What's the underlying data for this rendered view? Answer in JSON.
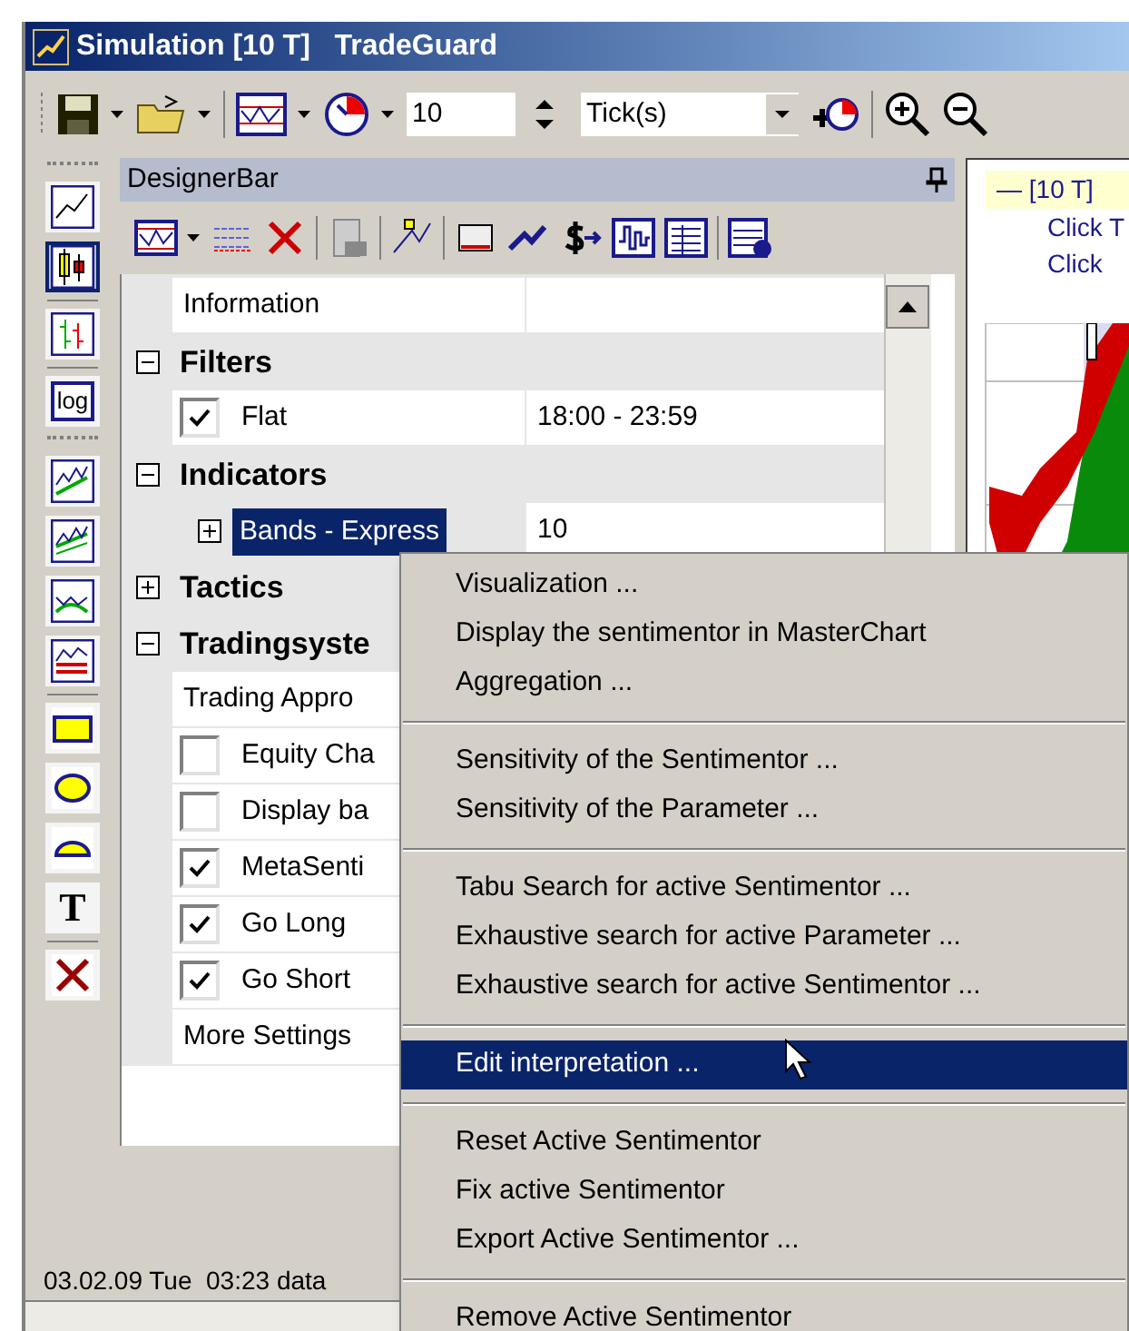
{
  "window": {
    "title": "Simulation [10 T]   TradeGuard"
  },
  "toolbar": {
    "period_value": "10",
    "unit": "Tick(s)"
  },
  "left_toolbar": {
    "tools": [
      {
        "selected": false
      },
      {
        "selected": true
      },
      {
        "selected": false
      },
      {
        "selected": false,
        "label": "log"
      },
      {
        "selected": false
      },
      {
        "selected": false
      },
      {
        "selected": false
      },
      {
        "selected": false
      },
      {
        "selected": false
      },
      {
        "selected": false
      },
      {
        "selected": false
      },
      {
        "selected": false,
        "label": "T"
      },
      {
        "selected": false
      }
    ]
  },
  "designer_bar": {
    "title": "DesignerBar",
    "rows": [
      {
        "kind": "property",
        "label": "Information"
      },
      {
        "kind": "category",
        "label": "Filters",
        "expanded": true,
        "children": [
          {
            "kind": "check",
            "label": "Flat",
            "checked": true,
            "value": "18:00 - 23:59"
          }
        ]
      },
      {
        "kind": "category",
        "label": "Indicators",
        "expanded": true,
        "children": [
          {
            "kind": "node",
            "label": "Bands - Express",
            "expanded": false,
            "selected": true,
            "value": "10"
          }
        ]
      },
      {
        "kind": "category",
        "label": "Tactics",
        "expanded": false
      },
      {
        "kind": "category",
        "label": "Tradingsyste",
        "expanded": true,
        "children": [
          {
            "kind": "property",
            "label": "Trading Appro"
          },
          {
            "kind": "check",
            "label": "Equity Cha",
            "checked": false
          },
          {
            "kind": "check",
            "label": "Display ba",
            "checked": false
          },
          {
            "kind": "check",
            "label": "MetaSenti",
            "checked": true
          },
          {
            "kind": "check",
            "label": "Go Long",
            "checked": true
          },
          {
            "kind": "check",
            "label": "Go Short",
            "checked": true
          },
          {
            "kind": "property",
            "label": "More Settings"
          }
        ]
      }
    ],
    "status": "03.02.09 Tue  03:23 data"
  },
  "chart": {
    "legend": "— [10 T]",
    "hints": [
      "Click T",
      "Click"
    ]
  },
  "context_menu": [
    {
      "kind": "item",
      "label": "Visualization ...",
      "selected": false
    },
    {
      "kind": "item",
      "label": "Display the sentimentor in MasterChart",
      "selected": false
    },
    {
      "kind": "item",
      "label": "Aggregation ...",
      "selected": false
    },
    {
      "kind": "separator"
    },
    {
      "kind": "item",
      "label": "Sensitivity of the Sentimentor ...",
      "selected": false
    },
    {
      "kind": "item",
      "label": "Sensitivity of the Parameter ...",
      "selected": false
    },
    {
      "kind": "separator"
    },
    {
      "kind": "item",
      "label": "Tabu Search for active Sentimentor ...",
      "selected": false
    },
    {
      "kind": "item",
      "label": "Exhaustive search for active Parameter ...",
      "selected": false
    },
    {
      "kind": "item",
      "label": "Exhaustive search for active Sentimentor ...",
      "selected": false
    },
    {
      "kind": "separator"
    },
    {
      "kind": "item",
      "label": "Edit interpretation ...",
      "selected": true
    },
    {
      "kind": "separator"
    },
    {
      "kind": "item",
      "label": "Reset Active Sentimentor",
      "selected": false
    },
    {
      "kind": "item",
      "label": "Fix active Sentimentor",
      "selected": false
    },
    {
      "kind": "item",
      "label": "Export Active Sentimentor ...",
      "selected": false
    },
    {
      "kind": "separator"
    },
    {
      "kind": "item",
      "label": "Remove Active Sentimentor",
      "selected": false
    }
  ]
}
